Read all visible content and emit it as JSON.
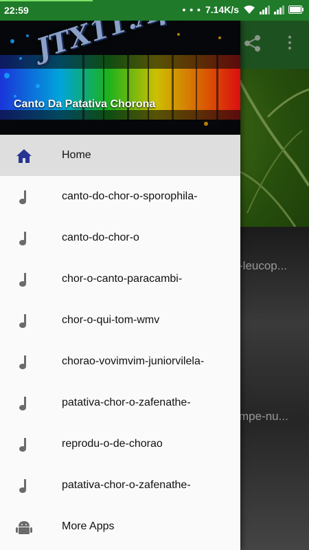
{
  "status_bar": {
    "time": "22:59",
    "notification_dots": "• • •",
    "speed": "7.14K/s"
  },
  "app_bar_icons": [
    "share-icon",
    "more-vert-icon"
  ],
  "background_items": [
    {
      "text": "-leucop..."
    },
    {
      "text": "mpe-nu..."
    }
  ],
  "drawer": {
    "header_logo": "JTX11.Apps",
    "header_title": "Canto Da Patativa Chorona",
    "items": [
      {
        "label": "Home",
        "icon": "home-icon",
        "active": true
      },
      {
        "label": "canto-do-chor-o-sporophila-",
        "icon": "music-note-icon"
      },
      {
        "label": "canto-do-chor-o",
        "icon": "music-note-icon"
      },
      {
        "label": "chor-o-canto-paracambi-",
        "icon": "music-note-icon"
      },
      {
        "label": "chor-o-qui-tom-wmv",
        "icon": "music-note-icon"
      },
      {
        "label": "chorao-vovimvim-juniorvilela-",
        "icon": "music-note-icon"
      },
      {
        "label": "patativa-chor-o-zafenathe-",
        "icon": "music-note-icon"
      },
      {
        "label": "reprodu-o-de-chorao",
        "icon": "music-note-icon"
      },
      {
        "label": "patativa-chor-o-zafenathe-",
        "icon": "music-note-icon"
      },
      {
        "label": "More Apps",
        "icon": "android-icon"
      }
    ]
  },
  "colors": {
    "status_bar": "#1f7a2a",
    "app_bar": "#2e7d32",
    "home_icon": "#283593",
    "note_icon": "#6b6b6b",
    "active_row": "#dedede"
  }
}
